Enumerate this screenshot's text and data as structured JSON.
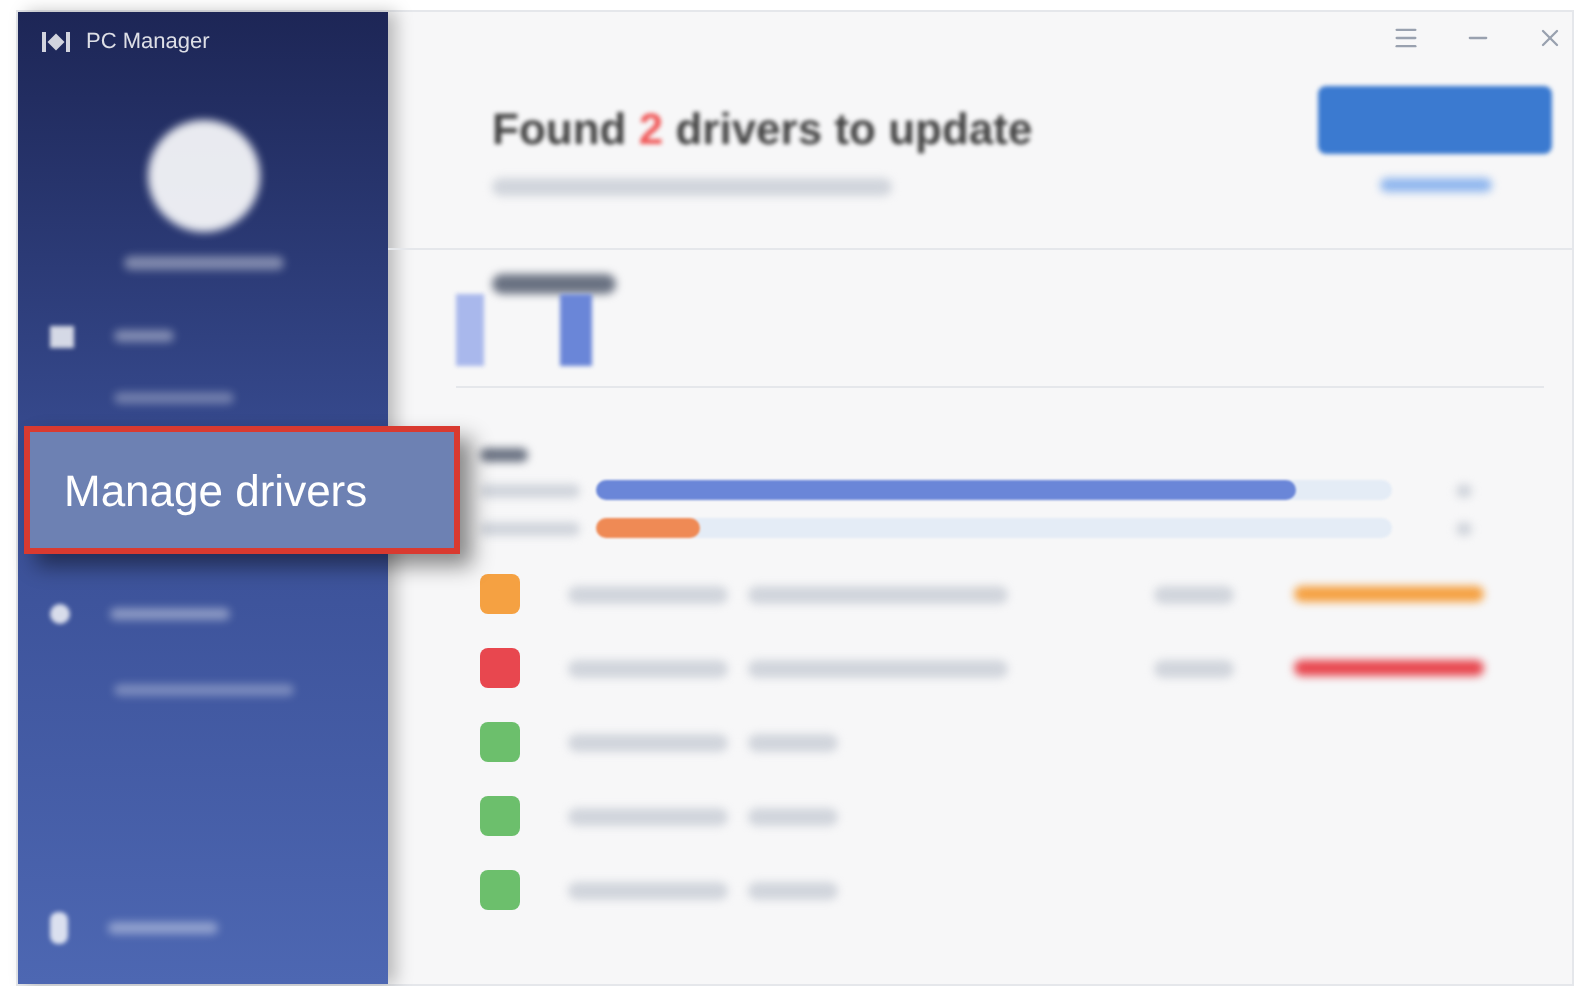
{
  "app": {
    "title": "PC Manager"
  },
  "callout": {
    "label": "Manage drivers"
  },
  "summary": {
    "headline_start": "Found",
    "count": "2",
    "headline_end": "drivers to update"
  },
  "usage_bars": [
    {
      "level": 0.88,
      "color": "#6a86d8"
    },
    {
      "level": 0.13,
      "color": "#ef8a55"
    }
  ],
  "drivers": [
    {
      "color": "#f5a142",
      "update": true
    },
    {
      "color": "#e8474f",
      "update": true
    },
    {
      "color": "#6cbf6c",
      "update": false
    },
    {
      "color": "#6cbf6c",
      "update": false
    },
    {
      "color": "#6cbf6c",
      "update": false
    }
  ]
}
